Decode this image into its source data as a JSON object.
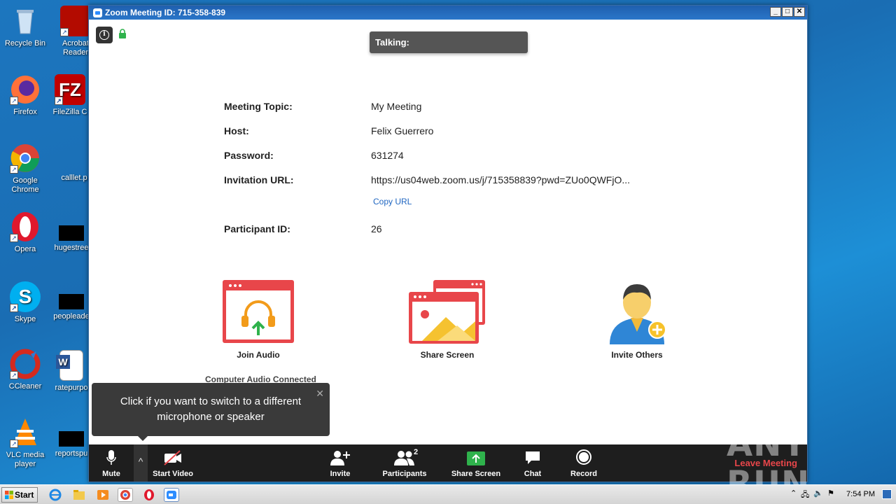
{
  "desktop": {
    "icons": [
      {
        "label": "Recycle Bin"
      },
      {
        "label": "Acrobat Reader"
      },
      {
        "label": "Firefox"
      },
      {
        "label": "FileZilla C"
      },
      {
        "label": "Google Chrome"
      },
      {
        "label": "calllet.p"
      },
      {
        "label": "Opera"
      },
      {
        "label": "hugestree"
      },
      {
        "label": "Skype"
      },
      {
        "label": "peopleade"
      },
      {
        "label": "CCleaner"
      },
      {
        "label": "ratepurpo"
      },
      {
        "label": "VLC media player"
      },
      {
        "label": "reportspu"
      }
    ]
  },
  "window": {
    "title": "Zoom Meeting ID: 715-358-839",
    "controls": {
      "minimize": "_",
      "maximize": "□",
      "close": "✕"
    }
  },
  "talking": {
    "label": "Talking:"
  },
  "meeting": {
    "topic_label": "Meeting Topic:",
    "topic": "My Meeting",
    "host_label": "Host:",
    "host": "Felix Guerrero",
    "password_label": "Password:",
    "password": "631274",
    "url_label": "Invitation URL:",
    "url": "https://us04web.zoom.us/j/715358839?pwd=ZUo0QWFjO...",
    "copy_url": "Copy URL",
    "participant_label": "Participant ID:",
    "participant_id": "26"
  },
  "actions": {
    "join_audio": "Join Audio",
    "share_screen": "Share Screen",
    "invite_others": "Invite Others",
    "audio_status": "Computer Audio Connected"
  },
  "tooltip": {
    "text": "Click if you want to switch to a different microphone or speaker",
    "close": "✕"
  },
  "toolbar": {
    "mute": "Mute",
    "chevron": "^",
    "start_video": "Start Video",
    "invite": "Invite",
    "participants": "Participants",
    "participant_count": "2",
    "share_screen": "Share Screen",
    "chat": "Chat",
    "record": "Record",
    "leave": "Leave Meeting"
  },
  "taskbar": {
    "start": "Start",
    "clock": "7:54 PM"
  },
  "watermark": "ANY RUN",
  "colors": {
    "zoom_blue": "#2d8cff",
    "accent_red": "#e8464a",
    "share_green": "#2fb24c",
    "toolbar_bg": "#1e1e1e"
  }
}
